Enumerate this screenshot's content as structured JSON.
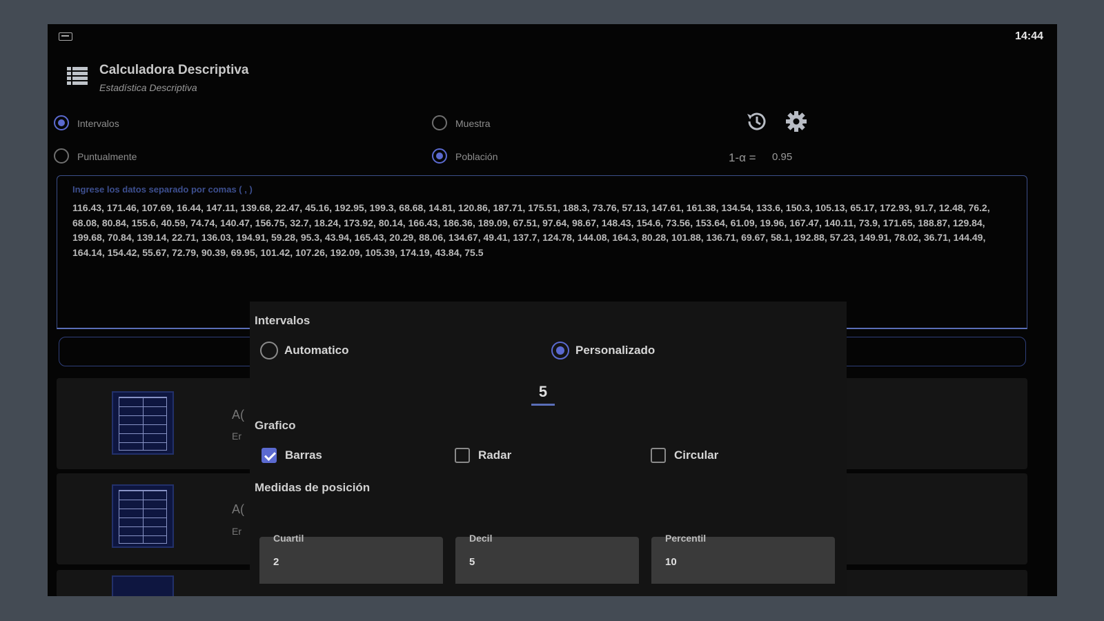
{
  "status_bar": {
    "time": "14:44"
  },
  "app_bar": {
    "title": "Calculadora Descriptiva",
    "subtitle": "Estadística Descriptiva"
  },
  "mode_options": {
    "left": [
      {
        "label": "Intervalos",
        "selected": true
      },
      {
        "label": "Puntualmente",
        "selected": false
      }
    ],
    "right": [
      {
        "label": "Muestra",
        "selected": false
      },
      {
        "label": "Población",
        "selected": true
      }
    ]
  },
  "tools": {
    "history_icon": "history-icon",
    "settings_icon": "gear-icon"
  },
  "confidence": {
    "label": "1-α =",
    "value": "0.95"
  },
  "data_input": {
    "placeholder": "Ingrese los datos separado por comas ( , )",
    "value": "116.43, 171.46, 107.69, 16.44, 147.11, 139.68, 22.47, 45.16, 192.95, 199.3, 68.68, 14.81, 120.86, 187.71, 175.51, 188.3, 73.76, 57.13, 147.61, 161.38, 134.54, 133.6, 150.3, 105.13, 65.17, 172.93, 91.7, 12.48, 76.2, 68.08, 80.84, 155.6, 40.59, 74.74, 140.47, 156.75, 32.7, 18.24, 173.92, 80.14, 166.43, 186.36, 189.09, 67.51, 97.64, 98.67, 148.43, 154.6, 73.56, 153.64, 61.09, 19.96, 167.47, 140.11, 73.9, 171.65, 188.87, 129.84, 199.68, 70.84, 139.14, 22.71, 136.03, 194.91, 59.28, 95.3, 43.94, 165.43, 20.29, 88.06, 134.67, 49.41, 137.7, 124.78, 144.08, 164.3, 80.28, 101.88, 136.71, 69.67, 58.1, 192.88, 57.23, 149.91, 78.02, 36.71, 144.49, 164.14, 154.42, 55.67, 72.79, 90.39, 69.95, 101.42, 107.26, 192.09, 105.39, 174.19, 43.84, 75.5"
  },
  "cards": [
    {
      "title_peek": "A(",
      "sub_peek": "Er"
    },
    {
      "title_peek": "A(",
      "sub_peek": "Er"
    }
  ],
  "dialog": {
    "intervals_title": "Intervalos",
    "interval_options": [
      {
        "label": "Automatico",
        "selected": false
      },
      {
        "label": "Personalizado",
        "selected": true
      }
    ],
    "custom_intervals_value": "5",
    "chart_title": "Grafico",
    "chart_options": [
      {
        "label": "Barras",
        "checked": true
      },
      {
        "label": "Radar",
        "checked": false
      },
      {
        "label": "Circular",
        "checked": false
      }
    ],
    "position_title": "Medidas de posición",
    "position_fields": [
      {
        "label": "Cuartil",
        "value": "2"
      },
      {
        "label": "Decil",
        "value": "5"
      },
      {
        "label": "Percentil",
        "value": "10"
      }
    ]
  },
  "colors": {
    "accent": "#5b6ad0",
    "background": "#050505",
    "frame": "#444b54"
  }
}
